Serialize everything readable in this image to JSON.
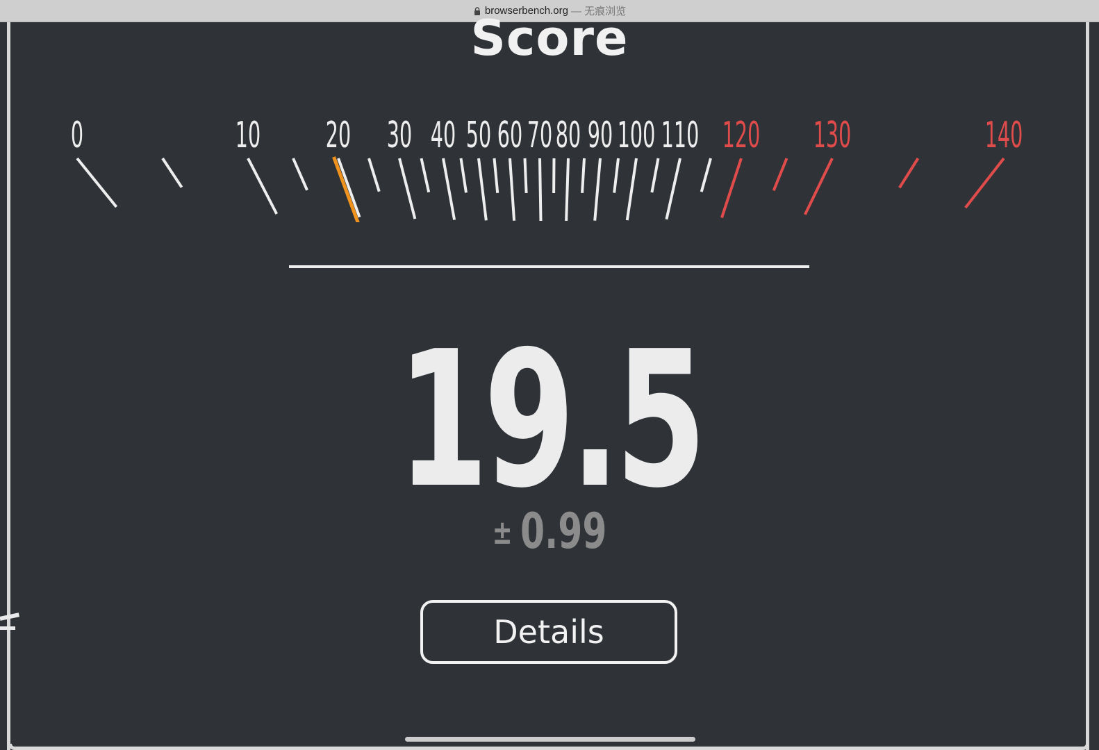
{
  "browser": {
    "host": "browserbench.org",
    "mode_label": "— 无痕浏览"
  },
  "page": {
    "title": "Score",
    "score": "19.5",
    "error_sign": "±",
    "error_value": "0.99",
    "details_label": "Details"
  },
  "gauge": {
    "labels": [
      "0",
      "10",
      "20",
      "30",
      "40",
      "50",
      "60",
      "70",
      "80",
      "90",
      "100",
      "110",
      "120",
      "130",
      "140"
    ],
    "min": 0,
    "max": 140,
    "value": 19.5,
    "red_from": 120,
    "colors": {
      "normal": "#eeeeee",
      "red": "#e04b4b",
      "needle": "#f0921e"
    }
  }
}
